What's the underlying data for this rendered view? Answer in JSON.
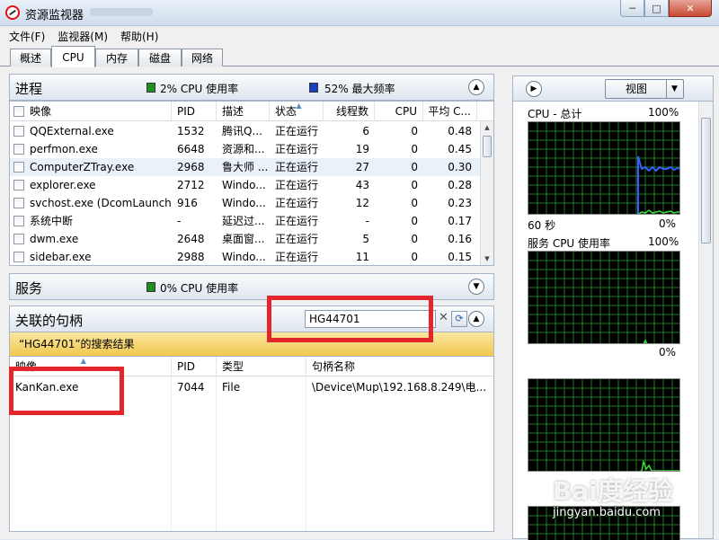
{
  "window": {
    "title": "资源监视器",
    "minimize": "─",
    "maximize": "□",
    "close": "✕"
  },
  "menu": [
    "文件(F)",
    "监视器(M)",
    "帮助(H)"
  ],
  "tabs": [
    "概述",
    "CPU",
    "内存",
    "磁盘",
    "网络"
  ],
  "active_tab": "CPU",
  "processes": {
    "title": "进程",
    "cpu_usage": "2% CPU 使用率",
    "max_freq": "52% 最大频率",
    "columns": [
      "映像",
      "PID",
      "描述",
      "状态",
      "线程数",
      "CPU",
      "平均 C..."
    ],
    "rows": [
      [
        "QQExternal.exe",
        "1532",
        "腾讯Q...",
        "正在运行",
        "6",
        "0",
        "0.48"
      ],
      [
        "perfmon.exe",
        "6648",
        "资源和...",
        "正在运行",
        "19",
        "0",
        "0.45"
      ],
      [
        "ComputerZTray.exe",
        "2968",
        "鲁大师 ...",
        "正在运行",
        "27",
        "0",
        "0.30"
      ],
      [
        "explorer.exe",
        "2712",
        "Windo...",
        "正在运行",
        "43",
        "0",
        "0.28"
      ],
      [
        "svchost.exe (DcomLaunch)",
        "916",
        "Windo...",
        "正在运行",
        "12",
        "0",
        "0.23"
      ],
      [
        "系统中断",
        "-",
        "延迟过...",
        "正在运行",
        "-",
        "0",
        "0.17"
      ],
      [
        "dwm.exe",
        "2648",
        "桌面窗...",
        "正在运行",
        "5",
        "0",
        "0.16"
      ],
      [
        "sidebar.exe",
        "2988",
        "Windo...",
        "正在运行",
        "11",
        "0",
        "0.15"
      ]
    ]
  },
  "services": {
    "title": "服务",
    "cpu_usage": "0% CPU 使用率"
  },
  "handles": {
    "title": "关联的句柄",
    "search_value": "HG44701",
    "result_text": "“HG44701”的搜索结果",
    "columns": [
      "映像",
      "PID",
      "类型",
      "句柄名称"
    ],
    "rows": [
      [
        "KanKan.exe",
        "7044",
        "File",
        "\\Device\\Mup\\192.168.8.249\\电..."
      ]
    ]
  },
  "right_pane": {
    "view_label": "视图",
    "cpu_total": {
      "title": "CPU - 总计",
      "max": "100%",
      "time": "60 秒",
      "min": "0%"
    },
    "service_cpu": {
      "title": "服务 CPU 使用率",
      "max": "100%",
      "min": "0%"
    }
  },
  "watermark": {
    "logo": "Bai度经验",
    "url": "jingyan.baidu.com"
  },
  "colors": {
    "cpu_green": "#1f8f1f",
    "freq_blue": "#1a3fc4",
    "highlight_red": "#e3262b",
    "banner_yellow": "#f5d56a"
  }
}
